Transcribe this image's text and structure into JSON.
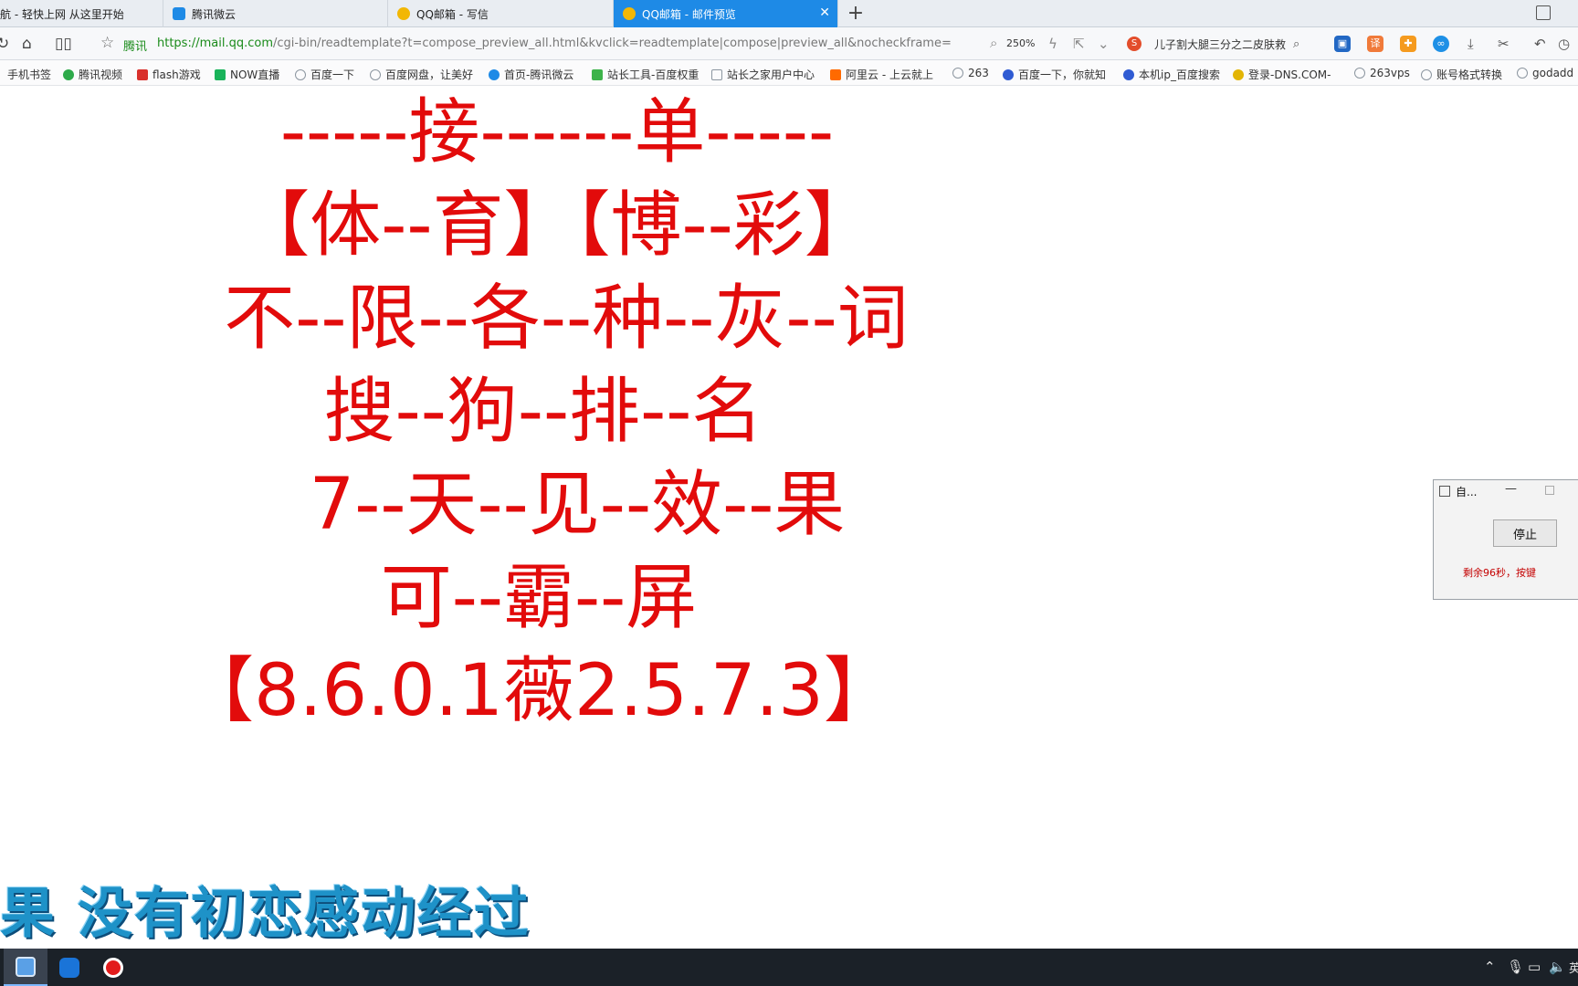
{
  "tabs": [
    {
      "label": "航 - 轻快上网 从这里开始",
      "icon": "globe-icon",
      "active": false
    },
    {
      "label": "腾讯微云",
      "icon": "cloud-icon",
      "active": false
    },
    {
      "label": "QQ邮箱 - 写信",
      "icon": "qqmail-icon",
      "active": false
    },
    {
      "label": "QQ邮箱 - 邮件预览",
      "icon": "qqmail-icon",
      "active": true
    }
  ],
  "address": {
    "site_label": "腾讯",
    "url_domain": "https://mail.qq.com",
    "url_path": "/cgi-bin/readtemplate?t=compose_preview_all.html&kvclick=readtemplate|compose|preview_all&nocheckframe=",
    "zoom": "250%",
    "search_text": "儿子割大腿三分之二皮肤救"
  },
  "bookmarks": [
    {
      "label": "手机书签",
      "color": "#9aa3ad"
    },
    {
      "label": "腾讯视频",
      "color": "#2eaa4a"
    },
    {
      "label": "flash游戏",
      "color": "#d9302c"
    },
    {
      "label": "NOW直播",
      "color": "#19b35a"
    },
    {
      "label": "百度一下",
      "color": "#8c96a0"
    },
    {
      "label": "百度网盘，让美好",
      "color": "#8c96a0"
    },
    {
      "label": "首页-腾讯微云",
      "color": "#1e8ae6"
    },
    {
      "label": "站长工具-百度权重",
      "color": "#3db34a"
    },
    {
      "label": "站长之家用户中心",
      "color": "#8c96a0"
    },
    {
      "label": "阿里云 - 上云就上",
      "color": "#ff6a00"
    },
    {
      "label": "263",
      "color": "#8c96a0"
    },
    {
      "label": "百度一下，你就知",
      "color": "#2f5bd3"
    },
    {
      "label": "本机ip_百度搜索",
      "color": "#2f5bd3"
    },
    {
      "label": "登录-DNS.COM-",
      "color": "#e3b505"
    },
    {
      "label": "263vps",
      "color": "#8c96a0"
    },
    {
      "label": "账号格式转换",
      "color": "#8c96a0"
    },
    {
      "label": "godadd",
      "color": "#8c96a0"
    }
  ],
  "content": {
    "lines": [
      "-----接------单-----",
      "【体--育】【博--彩】",
      "不--限--各--种--灰--词",
      "搜--狗--排--名",
      "7--天--见--效--果",
      "可--霸--屏",
      "【8.6.0.1薇2.5.7.3】"
    ],
    "color": "#e20b0b"
  },
  "subtitle": "果  没有初恋感动经过",
  "mini_window": {
    "title": "自...",
    "stop_label": "停止",
    "remaining_text": "剩余96秒，按键"
  },
  "tray": {
    "lang": "英"
  }
}
